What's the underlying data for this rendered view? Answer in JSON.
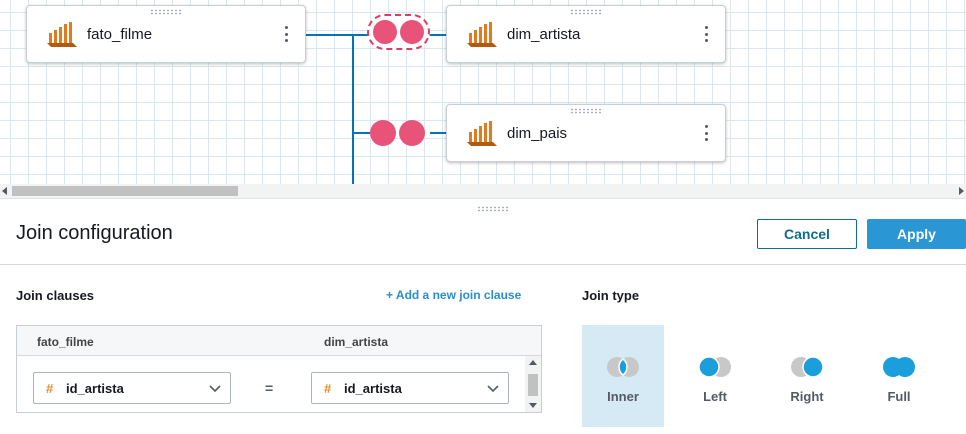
{
  "canvas": {
    "nodes": [
      {
        "id": "fato_filme",
        "label": "fato_filme"
      },
      {
        "id": "dim_artista",
        "label": "dim_artista"
      },
      {
        "id": "dim_pais",
        "label": "dim_pais"
      }
    ],
    "colors": {
      "line": "#0073bb",
      "join_circle": "#e8537a",
      "dataset_icon": "#e07b1e"
    }
  },
  "panel": {
    "title": "Join configuration",
    "cancel_label": "Cancel",
    "apply_label": "Apply",
    "join_clauses_heading": "Join clauses",
    "add_clause_label": "+ Add a new join clause",
    "join_type_heading": "Join type",
    "clause_table": {
      "left_header": "fato_filme",
      "right_header": "dim_artista",
      "rows": [
        {
          "left_field": "id_artista",
          "operator": "=",
          "right_field": "id_artista"
        }
      ]
    },
    "join_types": [
      {
        "label": "Inner",
        "selected": true
      },
      {
        "label": "Left",
        "selected": false
      },
      {
        "label": "Right",
        "selected": false
      },
      {
        "label": "Full",
        "selected": false
      }
    ],
    "colors": {
      "accent": "#2a96d3",
      "selected_bg": "#d6eaf6",
      "field_hash": "#e38d2a"
    }
  }
}
